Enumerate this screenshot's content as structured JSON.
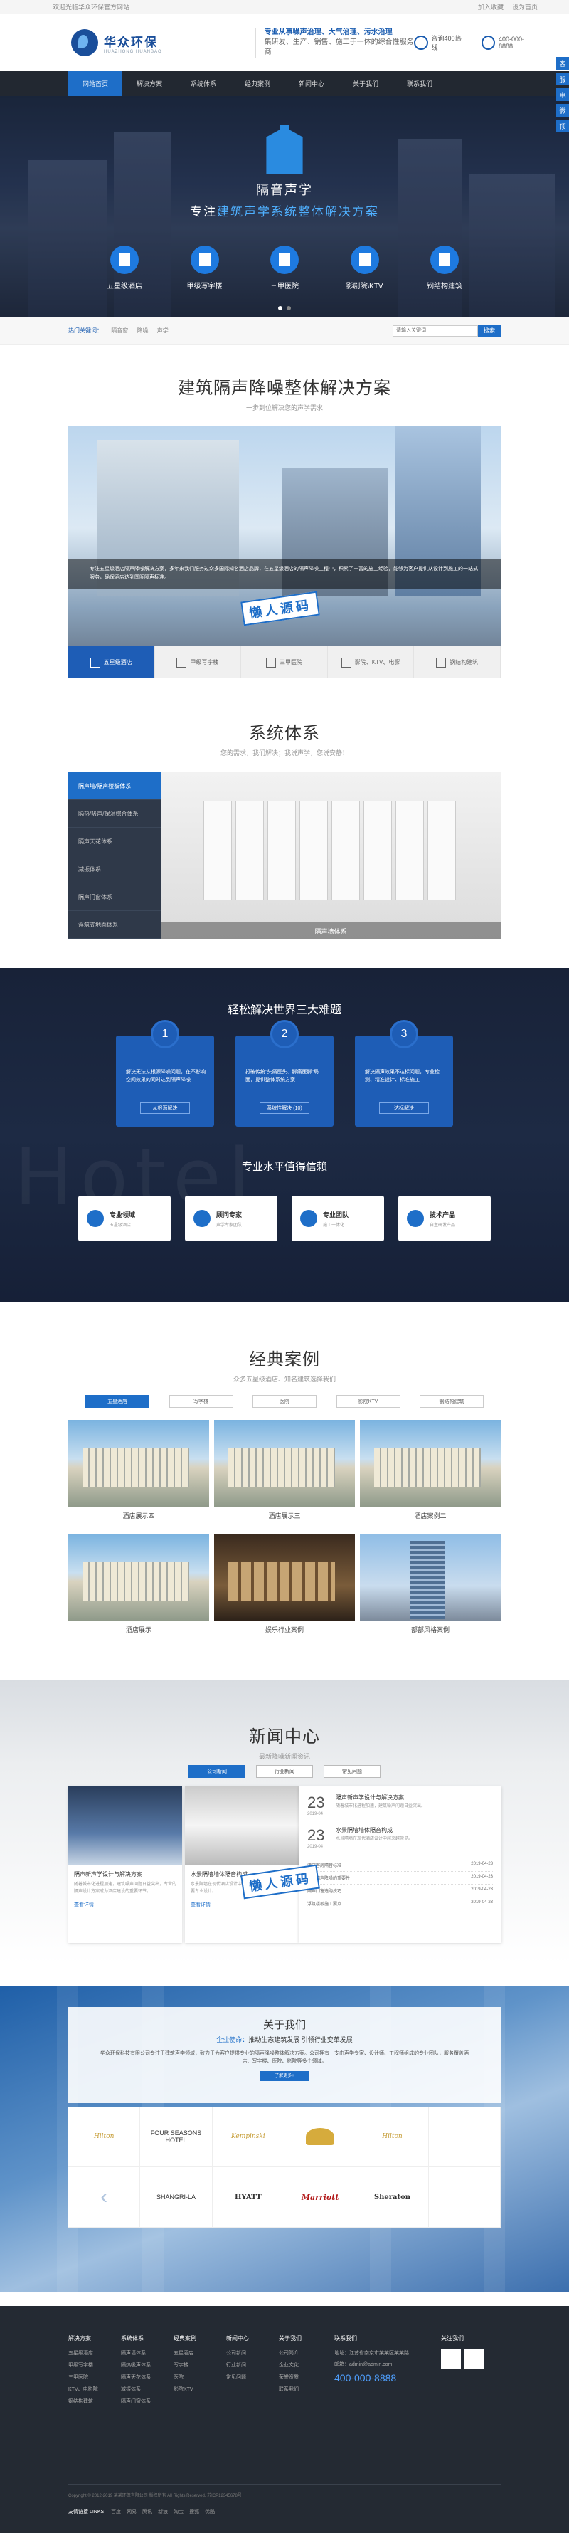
{
  "topbar": {
    "left": "欢迎光临华众环保官方网站",
    "login": "加入收藏",
    "fav": "设为首页"
  },
  "header": {
    "brand": "华众环保",
    "brand_sub": "HUAZHONG HUANBAO",
    "slogan1": "专业从事噪声治理、大气治理、污水治理",
    "slogan2": "集研发、生产、销售、施工于一体的综合性服务商",
    "contact1_label": "咨询400热线",
    "contact2": "400-000-8888"
  },
  "nav": [
    "网站首页",
    "解决方案",
    "系统体系",
    "经典案例",
    "新闻中心",
    "关于我们",
    "联系我们"
  ],
  "banner": {
    "title": "隔音声学",
    "subtitle_a": "专注",
    "subtitle_b": "建筑声学系统整体解决方案",
    "icons": [
      "五星级酒店",
      "甲级写字楼",
      "三甲医院",
      "影剧院\\KTV",
      "钢结构建筑"
    ]
  },
  "side": [
    "客",
    "服",
    "电",
    "微",
    "顶"
  ],
  "search": {
    "keywords": [
      "热门关键词：",
      "隔音窗",
      "降噪",
      "声学"
    ],
    "placeholder": "请输入关键词",
    "button": "搜索"
  },
  "solution": {
    "title": "建筑隔声降噪整体解决方案",
    "sub": "一步到位解决您的声学需求",
    "desc": "专注五星级酒店隔声降噪解决方案，多年来我们服务过众多国际知名酒店品牌，在五星级酒店的隔声降噪工程中，积累了丰富的施工经验，能够为客户提供从设计到施工的一站式服务，确保酒店达到国际隔声标准。",
    "tabs": [
      "五星级酒店",
      "甲级写字楼",
      "三甲医院",
      "影院、KTV、电影",
      "钢结构建筑"
    ]
  },
  "system": {
    "title": "系统体系",
    "sub": "您的需求，我们解决；我说声学，您说安静！",
    "items": [
      "隔声墙/隔声楼板体系",
      "隔热/吸声/保温综合体系",
      "隔声天花体系",
      "减振体系",
      "隔声门窗体系",
      "浮筑式地面体系"
    ],
    "caption": "隔声墙体系"
  },
  "problems": {
    "title": "轻松解决世界三大难题",
    "items": [
      {
        "n": "1",
        "t": "解决无法从根源降噪问题，在不影响空间效果的同时达到隔声降噪",
        "b": "从根源解决"
      },
      {
        "n": "2",
        "t": "打破传统\"头痛医头、脚痛医脚\"局面，提供整体系统方案",
        "b": "系统性解决 (10)"
      },
      {
        "n": "3",
        "t": "解决隔声效果不达标问题，专业检测、精准设计、标准施工",
        "b": "达标解决"
      }
    ]
  },
  "trust": {
    "title": "专业水平值得信赖",
    "bg_word": "Hotel",
    "items": [
      {
        "t": "专业领域",
        "s": "五星级酒店"
      },
      {
        "t": "顾问专家",
        "s": "声学专家团队"
      },
      {
        "t": "专业团队",
        "s": "施工一体化"
      },
      {
        "t": "技术产品",
        "s": "自主研发产品"
      }
    ]
  },
  "cases": {
    "title": "经典案例",
    "sub": "众多五星级酒店、知名建筑选择我们",
    "tabs": [
      "五星酒店",
      "写字楼",
      "医院",
      "影院KTV",
      "钢结构建筑"
    ],
    "items": [
      "酒店展示四",
      "酒店展示三",
      "酒店案例二",
      "酒店展示",
      "娱乐行业案例",
      "部部风格案例"
    ]
  },
  "news": {
    "title": "新闻中心",
    "sub": "最新降噪新闻资讯",
    "tabs": [
      "公司新闻",
      "行业新闻",
      "常见问题"
    ],
    "card1": {
      "t": "隔声新声学设计与解决方案",
      "d": "随着城市化进程加速，建筑噪声问题日益突出，专业的隔声设计方案成为酒店建设的重要环节。",
      "m": "查看详情"
    },
    "card2": {
      "t": "水景隔墙墙体隔音构成",
      "d": "水景隔墙在现代酒店设计中越来越常见，其隔音构造需要专业设计。",
      "m": "查看详情"
    },
    "dated": [
      {
        "day": "23",
        "ym": "2019-04",
        "t": "隔声新声学设计与解决方案",
        "d": "随着城市化进程加速，建筑噪声问题日益突出。"
      },
      {
        "day": "23",
        "ym": "2019-04",
        "t": "水景隔墙墙体隔音构成",
        "d": "水景隔墙在现代酒店设计中越来越常见。"
      }
    ],
    "list": [
      {
        "t": "酒店客房隔音标准",
        "d": "2019-04-23"
      },
      {
        "t": "酒店隔声降噪的重要性",
        "d": "2019-04-23"
      },
      {
        "t": "隔声门窗选购技巧",
        "d": "2019-04-23"
      },
      {
        "t": "浮筑楼板施工要点",
        "d": "2019-04-23"
      }
    ]
  },
  "about": {
    "title": "关于我们",
    "sub_a": "企业使命：",
    "sub_b": "推动生态建筑发展 引领行业变革发展",
    "desc": "华众环保科技有限公司专注于建筑声学领域，致力于为客户提供专业的隔声降噪整体解决方案。公司拥有一支由声学专家、设计师、工程师组成的专业团队，服务覆盖酒店、写字楼、医院、影院等多个领域。",
    "btn": "了解更多+",
    "brands": [
      "Hilton",
      "FOUR SEASONS HOTEL",
      "Kempinski",
      "",
      "Hilton",
      "",
      "",
      "SHANGRI-LA",
      "HYATT",
      "Marriott",
      "Sheraton",
      ""
    ]
  },
  "footer": {
    "cols": [
      {
        "h": "解决方案",
        "items": [
          "五星级酒店",
          "甲级写字楼",
          "三甲医院",
          "KTV、电影院",
          "钢结构建筑"
        ]
      },
      {
        "h": "系统体系",
        "items": [
          "隔声墙体系",
          "隔热吸声体系",
          "隔声天花体系",
          "减振体系",
          "隔声门窗体系"
        ]
      },
      {
        "h": "经典案例",
        "items": [
          "五星酒店",
          "写字楼",
          "医院",
          "影院KTV"
        ]
      },
      {
        "h": "新闻中心",
        "items": [
          "公司新闻",
          "行业新闻",
          "常见问题"
        ]
      },
      {
        "h": "关于我们",
        "items": [
          "公司简介",
          "企业文化",
          "荣誉资质",
          "联系我们"
        ]
      }
    ],
    "contact_h": "联系我们",
    "contact_addr": "地址：江苏省南京市某某区某某路",
    "contact_mail": "邮箱：admin@admin.com",
    "phone": "400-000-8888",
    "qr_h": "关注我们",
    "copy": "Copyright © 2012-2019 某某环保有限公司 版权所有 All Rights Reserved. 苏ICP12345678号",
    "links_h": "友情链接 LINKS",
    "links": [
      "百度",
      "网易",
      "腾讯",
      "新浪",
      "淘宝",
      "搜狐",
      "优酷"
    ]
  },
  "watermark": "懒人源码"
}
